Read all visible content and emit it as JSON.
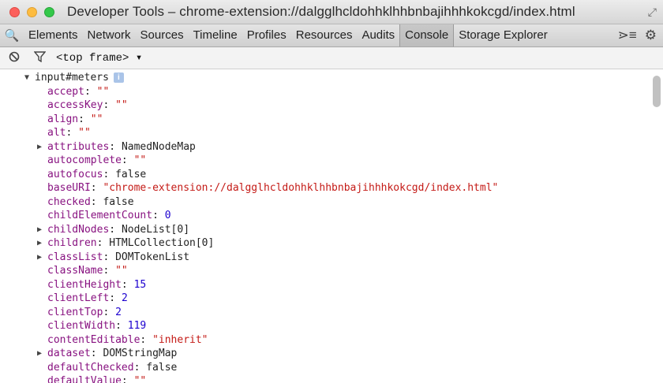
{
  "window": {
    "title": "Developer Tools – chrome-extension://dalgglhcldohhklhhbnbajihhhkokcgd/index.html",
    "resize_glyph": "⤢"
  },
  "toolbar": {
    "search_glyph": "🔍",
    "tabs": [
      "Elements",
      "Network",
      "Sources",
      "Timeline",
      "Profiles",
      "Resources",
      "Audits",
      "Console",
      "Storage Explorer"
    ],
    "active_tab": "Console",
    "drawer_glyph": "⋗≡",
    "gear_glyph": "⚙"
  },
  "console": {
    "clear_glyph": "⃠",
    "filter_glyph": "⊽",
    "frame_selector": "<top frame> ▾"
  },
  "tree": {
    "root": {
      "label": "input#meters",
      "info": "i"
    },
    "props": [
      {
        "key": "accept",
        "value": "\"\"",
        "type": "str",
        "expandable": false
      },
      {
        "key": "accessKey",
        "value": "\"\"",
        "type": "str",
        "expandable": false
      },
      {
        "key": "align",
        "value": "\"\"",
        "type": "str",
        "expandable": false
      },
      {
        "key": "alt",
        "value": "\"\"",
        "type": "str",
        "expandable": false
      },
      {
        "key": "attributes",
        "value": "NamedNodeMap",
        "type": "plain",
        "expandable": true
      },
      {
        "key": "autocomplete",
        "value": "\"\"",
        "type": "str",
        "expandable": false
      },
      {
        "key": "autofocus",
        "value": "false",
        "type": "plain",
        "expandable": false
      },
      {
        "key": "baseURI",
        "value": "\"chrome-extension://dalgglhcldohhklhhbnbajihhhkokcgd/index.html\"",
        "type": "str",
        "expandable": false
      },
      {
        "key": "checked",
        "value": "false",
        "type": "plain",
        "expandable": false
      },
      {
        "key": "childElementCount",
        "value": "0",
        "type": "num",
        "expandable": false
      },
      {
        "key": "childNodes",
        "value": "NodeList[0]",
        "type": "plain",
        "expandable": true
      },
      {
        "key": "children",
        "value": "HTMLCollection[0]",
        "type": "plain",
        "expandable": true
      },
      {
        "key": "classList",
        "value": "DOMTokenList",
        "type": "plain",
        "expandable": true
      },
      {
        "key": "className",
        "value": "\"\"",
        "type": "str",
        "expandable": false
      },
      {
        "key": "clientHeight",
        "value": "15",
        "type": "num",
        "expandable": false
      },
      {
        "key": "clientLeft",
        "value": "2",
        "type": "num",
        "expandable": false
      },
      {
        "key": "clientTop",
        "value": "2",
        "type": "num",
        "expandable": false
      },
      {
        "key": "clientWidth",
        "value": "119",
        "type": "num",
        "expandable": false
      },
      {
        "key": "contentEditable",
        "value": "\"inherit\"",
        "type": "str",
        "expandable": false
      },
      {
        "key": "dataset",
        "value": "DOMStringMap",
        "type": "plain",
        "expandable": true
      },
      {
        "key": "defaultChecked",
        "value": "false",
        "type": "plain",
        "expandable": false
      },
      {
        "key": "defaultValue",
        "value": "\"\"",
        "type": "str",
        "expandable": false
      }
    ]
  }
}
